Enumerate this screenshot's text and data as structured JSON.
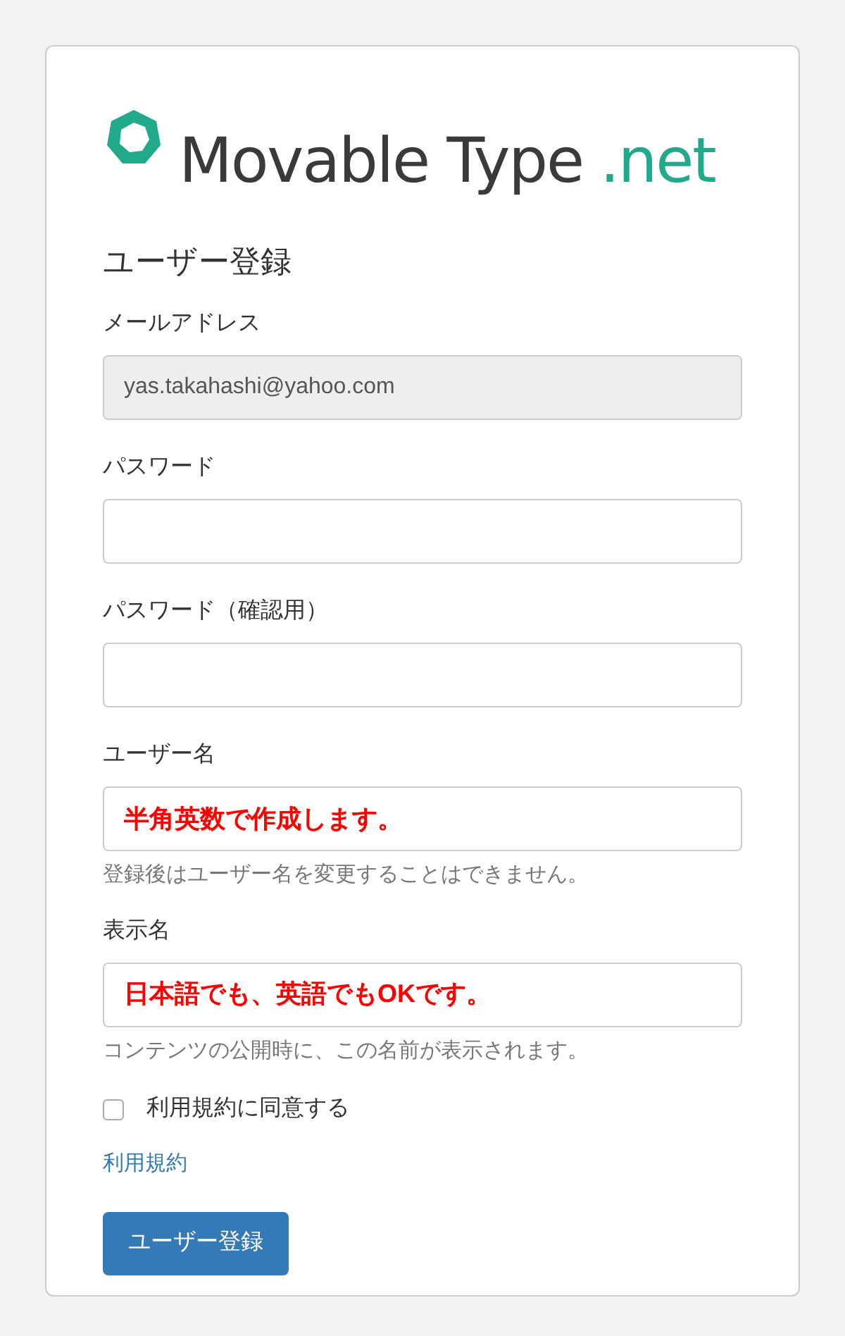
{
  "logo": {
    "name": "Movable Type",
    "suffix": ".net"
  },
  "title": "ユーザー登録",
  "fields": [
    {
      "label": "メールアドレス",
      "value": "yas.takahashi@yahoo.com",
      "disabled": true
    },
    {
      "label": "パスワード",
      "disabled": false
    },
    {
      "label": "パスワード（確認用）",
      "disabled": false
    },
    {
      "label": "ユーザー名",
      "annotation": "半角英数で作成します。",
      "help": "登録後はユーザー名を変更することはできません。",
      "disabled": false
    },
    {
      "label": "表示名",
      "annotation": "日本語でも、英語でもOKです。",
      "help": "コンテンツの公開時に、この名前が表示されます。",
      "disabled": false
    }
  ],
  "agree": {
    "label": "利用規約に同意する",
    "checked": false
  },
  "terms_link": "利用規約",
  "submit": "ユーザー登録"
}
